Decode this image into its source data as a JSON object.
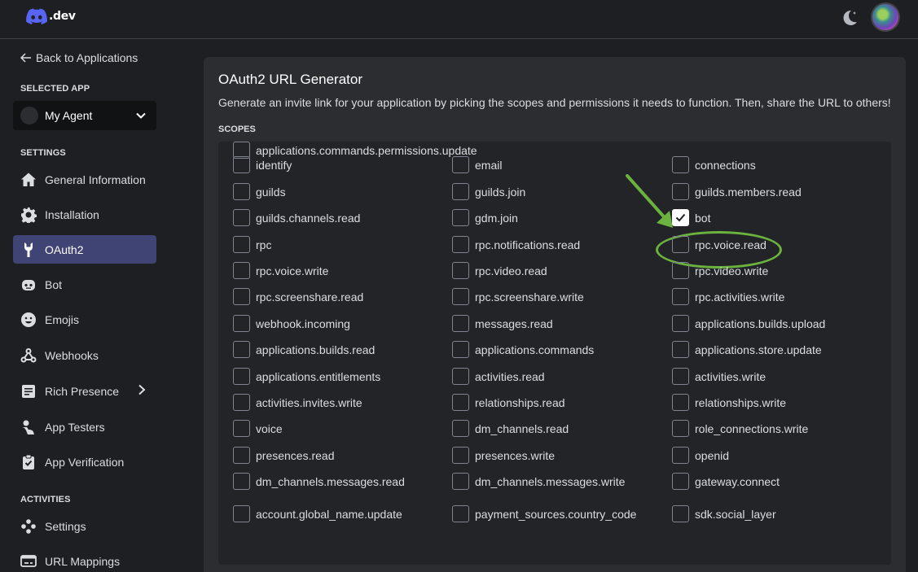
{
  "app": {
    "logo_text": ".dev",
    "theme_icon": "moon-icon",
    "avatar_icon": "avatar"
  },
  "sidebar": {
    "back_label": "Back to Applications",
    "selected_app_label": "SELECTED APP",
    "selected_app_name": "My Agent",
    "settings_label": "SETTINGS",
    "settings_items": [
      {
        "label": "General Information",
        "icon": "home-icon"
      },
      {
        "label": "Installation",
        "icon": "gear-icon"
      },
      {
        "label": "OAuth2",
        "icon": "wrench-icon",
        "active": true
      },
      {
        "label": "Bot",
        "icon": "bot-icon"
      },
      {
        "label": "Emojis",
        "icon": "smiley-icon"
      },
      {
        "label": "Webhooks",
        "icon": "webhook-icon"
      },
      {
        "label": "Rich Presence",
        "icon": "document-icon"
      },
      {
        "label": "App Testers",
        "icon": "user-icon"
      },
      {
        "label": "App Verification",
        "icon": "clipboard-check-icon"
      }
    ],
    "activities_label": "ACTIVITIES",
    "activities_items": [
      {
        "label": "Settings",
        "icon": "gamepad-icon"
      },
      {
        "label": "URL Mappings",
        "icon": "url-mapping-icon"
      }
    ]
  },
  "main": {
    "title": "OAuth2 URL Generator",
    "description": "Generate an invite link for your application by picking the scopes and permissions it needs to function. Then, share the URL to others!",
    "scopes_label": "SCOPES",
    "scopes": [
      {
        "label": "identify",
        "checked": false
      },
      {
        "label": "email",
        "checked": false
      },
      {
        "label": "connections",
        "checked": false
      },
      {
        "label": "guilds",
        "checked": false
      },
      {
        "label": "guilds.join",
        "checked": false
      },
      {
        "label": "guilds.members.read",
        "checked": false
      },
      {
        "label": "guilds.channels.read",
        "checked": false
      },
      {
        "label": "gdm.join",
        "checked": false
      },
      {
        "label": "bot",
        "checked": true
      },
      {
        "label": "rpc",
        "checked": false
      },
      {
        "label": "rpc.notifications.read",
        "checked": false
      },
      {
        "label": "rpc.voice.read",
        "checked": false
      },
      {
        "label": "rpc.voice.write",
        "checked": false
      },
      {
        "label": "rpc.video.read",
        "checked": false
      },
      {
        "label": "rpc.video.write",
        "checked": false
      },
      {
        "label": "rpc.screenshare.read",
        "checked": false
      },
      {
        "label": "rpc.screenshare.write",
        "checked": false
      },
      {
        "label": "rpc.activities.write",
        "checked": false
      },
      {
        "label": "webhook.incoming",
        "checked": false
      },
      {
        "label": "messages.read",
        "checked": false
      },
      {
        "label": "applications.builds.upload",
        "checked": false
      },
      {
        "label": "applications.builds.read",
        "checked": false
      },
      {
        "label": "applications.commands",
        "checked": false
      },
      {
        "label": "applications.store.update",
        "checked": false
      },
      {
        "label": "applications.entitlements",
        "checked": false
      },
      {
        "label": "activities.read",
        "checked": false
      },
      {
        "label": "activities.write",
        "checked": false
      },
      {
        "label": "activities.invites.write",
        "checked": false
      },
      {
        "label": "relationships.read",
        "checked": false
      },
      {
        "label": "relationships.write",
        "checked": false
      },
      {
        "label": "voice",
        "checked": false
      },
      {
        "label": "dm_channels.read",
        "checked": false
      },
      {
        "label": "role_connections.write",
        "checked": false
      },
      {
        "label": "presences.read",
        "checked": false
      },
      {
        "label": "presences.write",
        "checked": false
      },
      {
        "label": "openid",
        "checked": false
      },
      {
        "label": "dm_channels.messages.read",
        "checked": false
      },
      {
        "label": "dm_channels.messages.write",
        "checked": false
      },
      {
        "label": "gateway.connect",
        "checked": false
      },
      {
        "label": "account.global_name.update",
        "checked": false
      },
      {
        "label": "payment_sources.country_code",
        "checked": false
      },
      {
        "label": "sdk.social_layer",
        "checked": false
      },
      {
        "label": "applications.commands.permissions.update",
        "checked": false
      }
    ]
  },
  "colors": {
    "accent_active": "#3f4474",
    "annotation": "#6bb23e"
  }
}
